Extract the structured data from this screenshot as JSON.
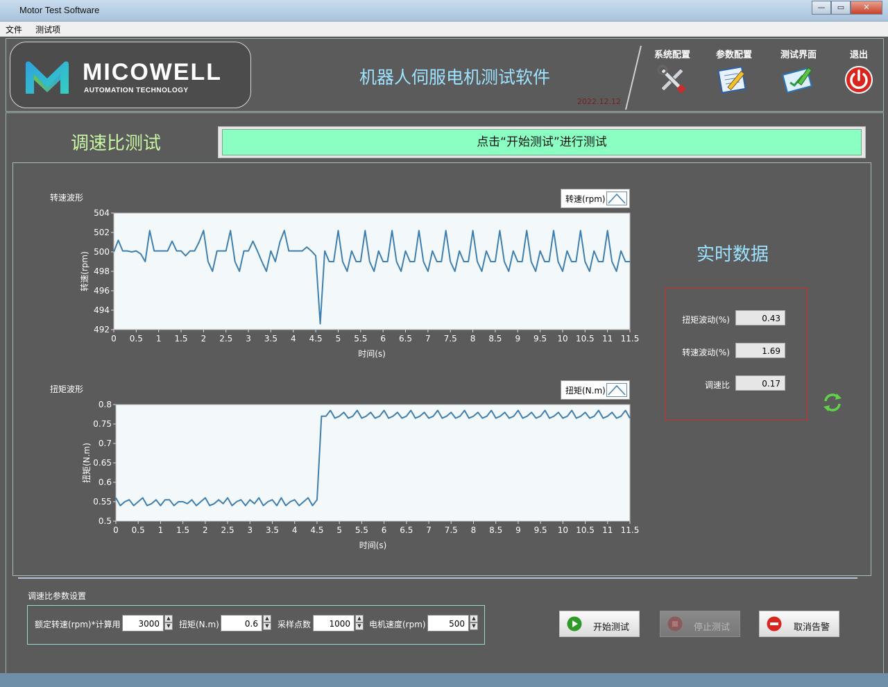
{
  "window": {
    "title": "Motor Test Software",
    "minimize": "—",
    "maximize": "▭",
    "close": "✕"
  },
  "menu": [
    {
      "label": "文件"
    },
    {
      "label": "测试项"
    }
  ],
  "logo": {
    "brand": "MICOWELL",
    "sub": "AUTOMATION TECHNOLOGY"
  },
  "header": {
    "title": "机器人伺服电机测试软件",
    "date": "2022.12.12"
  },
  "toolbar": [
    {
      "label": "系统配置",
      "icon": "tools-icon"
    },
    {
      "label": "参数配置",
      "icon": "edit-document-icon"
    },
    {
      "label": "测试界面",
      "icon": "test-clipboard-icon"
    },
    {
      "label": "退出",
      "icon": "power-icon"
    }
  ],
  "page": {
    "title": "调速比测试",
    "status": "点击“开始测试”进行测试"
  },
  "chart_data": [
    {
      "type": "line",
      "title": "转速波形",
      "legend": "转速(rpm)",
      "xlabel": "时间(s)",
      "ylabel": "转速(rpm)",
      "xlim": [
        0,
        11.5
      ],
      "ylim": [
        492,
        504
      ],
      "x_ticks": [
        "0",
        "0.5",
        "1",
        "1.5",
        "2",
        "2.5",
        "3",
        "3.5",
        "4",
        "4.5",
        "5",
        "5.5",
        "6",
        "6.5",
        "7",
        "7.5",
        "8",
        "8.5",
        "9",
        "9.5",
        "10",
        "10.5",
        "11",
        "11.5"
      ],
      "y_ticks": [
        "504",
        "502",
        "500",
        "498",
        "496",
        "494",
        "492"
      ],
      "color": "#3f7fb0",
      "series": [
        {
          "x": [
            0,
            0.1,
            0.2,
            0.3,
            0.4,
            0.5,
            0.6,
            0.7,
            0.8,
            0.9,
            1.0,
            1.1,
            1.2,
            1.3,
            1.4,
            1.5,
            1.6,
            1.7,
            1.8,
            1.9,
            2.0,
            2.1,
            2.2,
            2.3,
            2.4,
            2.5,
            2.6,
            2.7,
            2.8,
            2.9,
            3.0,
            3.1,
            3.2,
            3.3,
            3.4,
            3.5,
            3.6,
            3.7,
            3.8,
            3.9,
            4.0,
            4.1,
            4.2,
            4.3,
            4.4,
            4.5,
            4.6,
            4.7,
            4.8,
            4.9,
            5.0,
            5.1,
            5.2,
            5.3,
            5.4,
            5.5,
            5.6,
            5.7,
            5.8,
            5.9,
            6.0,
            6.1,
            6.2,
            6.3,
            6.4,
            6.5,
            6.6,
            6.7,
            6.8,
            6.9,
            7.0,
            7.1,
            7.2,
            7.3,
            7.4,
            7.5,
            7.6,
            7.7,
            7.8,
            7.9,
            8.0,
            8.1,
            8.2,
            8.3,
            8.4,
            8.5,
            8.6,
            8.7,
            8.8,
            8.9,
            9.0,
            9.1,
            9.2,
            9.3,
            9.4,
            9.5,
            9.6,
            9.7,
            9.8,
            9.9,
            10.0,
            10.1,
            10.2,
            10.3,
            10.4,
            10.5,
            10.6,
            10.7,
            10.8,
            10.9,
            11.0,
            11.1,
            11.2,
            11.3,
            11.4,
            11.5
          ],
          "values": [
            500,
            501.2,
            500.1,
            500.1,
            500,
            500.1,
            499.8,
            499,
            502.2,
            500.1,
            500.1,
            500.1,
            500.1,
            501.1,
            500.1,
            500.1,
            499.6,
            500.1,
            500.1,
            501,
            502.2,
            499,
            498,
            500.1,
            500.1,
            500.1,
            502.2,
            499,
            498,
            500.1,
            500.1,
            501.1,
            500.1,
            499,
            498,
            500.1,
            499,
            501,
            502.2,
            500.1,
            500.1,
            500.1,
            500.1,
            500.5,
            500.1,
            499.6,
            492.6,
            500.1,
            499,
            499,
            502.2,
            499,
            498,
            500.1,
            499,
            499,
            502.2,
            499,
            498,
            500.1,
            499,
            499,
            502.2,
            499,
            498,
            500.1,
            499,
            499,
            502.2,
            499,
            498,
            500.1,
            499,
            499,
            502.2,
            499,
            498,
            500.1,
            499,
            499,
            502.2,
            499,
            498,
            500.1,
            499,
            499,
            502.2,
            499,
            498,
            500.1,
            499,
            499,
            502.2,
            499,
            498,
            500.1,
            499,
            499,
            502.2,
            499,
            498,
            500.1,
            499,
            499,
            502.2,
            499,
            498,
            500.1,
            499,
            499,
            502.2,
            499,
            498,
            500.1,
            499,
            499
          ]
        }
      ]
    },
    {
      "type": "line",
      "title": "扭矩波形",
      "legend": "扭矩(N.m)",
      "xlabel": "时间(s)",
      "ylabel": "扭矩(N.m)",
      "xlim": [
        0,
        11.5
      ],
      "ylim": [
        0.5,
        0.8
      ],
      "x_ticks": [
        "0",
        "0.5",
        "1",
        "1.5",
        "2",
        "2.5",
        "3",
        "3.5",
        "4",
        "4.5",
        "5",
        "5.5",
        "6",
        "6.5",
        "7",
        "7.5",
        "8",
        "8.5",
        "9",
        "9.5",
        "10",
        "10.5",
        "11",
        "11.5"
      ],
      "y_ticks": [
        "0.8",
        "0.75",
        "0.7",
        "0.65",
        "0.6",
        "0.55",
        "0.5"
      ],
      "color": "#3f7fb0",
      "series": [
        {
          "x": [
            0,
            0.1,
            0.2,
            0.3,
            0.4,
            0.5,
            0.6,
            0.7,
            0.8,
            0.9,
            1.0,
            1.1,
            1.2,
            1.3,
            1.4,
            1.5,
            1.6,
            1.7,
            1.8,
            1.9,
            2.0,
            2.1,
            2.2,
            2.3,
            2.4,
            2.5,
            2.6,
            2.7,
            2.8,
            2.9,
            3.0,
            3.1,
            3.2,
            3.3,
            3.4,
            3.5,
            3.6,
            3.7,
            3.8,
            3.9,
            4.0,
            4.1,
            4.2,
            4.3,
            4.4,
            4.5,
            4.6,
            4.7,
            4.8,
            4.9,
            5.0,
            5.1,
            5.2,
            5.3,
            5.4,
            5.5,
            5.6,
            5.7,
            5.8,
            5.9,
            6.0,
            6.1,
            6.2,
            6.3,
            6.4,
            6.5,
            6.6,
            6.7,
            6.8,
            6.9,
            7.0,
            7.1,
            7.2,
            7.3,
            7.4,
            7.5,
            7.6,
            7.7,
            7.8,
            7.9,
            8.0,
            8.1,
            8.2,
            8.3,
            8.4,
            8.5,
            8.6,
            8.7,
            8.8,
            8.9,
            9.0,
            9.1,
            9.2,
            9.3,
            9.4,
            9.5,
            9.6,
            9.7,
            9.8,
            9.9,
            10.0,
            10.1,
            10.2,
            10.3,
            10.4,
            10.5,
            10.6,
            10.7,
            10.8,
            10.9,
            11.0,
            11.1,
            11.2,
            11.3,
            11.4,
            11.5
          ],
          "values": [
            0.56,
            0.54,
            0.55,
            0.555,
            0.54,
            0.55,
            0.56,
            0.54,
            0.545,
            0.555,
            0.54,
            0.555,
            0.555,
            0.54,
            0.55,
            0.55,
            0.545,
            0.555,
            0.54,
            0.55,
            0.56,
            0.54,
            0.545,
            0.555,
            0.545,
            0.56,
            0.54,
            0.55,
            0.555,
            0.54,
            0.555,
            0.545,
            0.56,
            0.54,
            0.55,
            0.555,
            0.54,
            0.56,
            0.54,
            0.55,
            0.555,
            0.54,
            0.55,
            0.56,
            0.54,
            0.555,
            0.77,
            0.77,
            0.785,
            0.765,
            0.77,
            0.78,
            0.765,
            0.77,
            0.785,
            0.765,
            0.77,
            0.78,
            0.765,
            0.77,
            0.785,
            0.765,
            0.77,
            0.78,
            0.765,
            0.77,
            0.785,
            0.765,
            0.77,
            0.78,
            0.765,
            0.77,
            0.785,
            0.765,
            0.77,
            0.78,
            0.765,
            0.77,
            0.785,
            0.765,
            0.77,
            0.78,
            0.765,
            0.77,
            0.785,
            0.765,
            0.77,
            0.78,
            0.765,
            0.77,
            0.785,
            0.765,
            0.77,
            0.78,
            0.765,
            0.77,
            0.785,
            0.765,
            0.77,
            0.78,
            0.765,
            0.77,
            0.785,
            0.765,
            0.77,
            0.78,
            0.765,
            0.77,
            0.785,
            0.765,
            0.77,
            0.78,
            0.765,
            0.77,
            0.785,
            0.765
          ]
        }
      ]
    }
  ],
  "realtime": {
    "title": "实时数据",
    "rows": [
      {
        "label": "扭矩波动(%)",
        "value": "0.43"
      },
      {
        "label": "转速波动(%)",
        "value": "1.69"
      },
      {
        "label": "调速比",
        "value": "0.17"
      }
    ]
  },
  "params": {
    "title": "调速比参数设置",
    "fields": [
      {
        "label": "额定转速(rpm)*计算用",
        "value": "3000"
      },
      {
        "label": "扭矩(N.m)",
        "value": "0.6"
      },
      {
        "label": "采样点数",
        "value": "1000"
      },
      {
        "label": "电机速度(rpm)",
        "value": "500"
      }
    ]
  },
  "actions": {
    "start": "开始测试",
    "stop": "停止测试",
    "cancel": "取消告警"
  },
  "colors": {
    "accent_green": "#8bffc2",
    "title_cyan": "#9de3ff",
    "section_green": "#c8f7a2",
    "alert_red": "#d32c2c"
  }
}
